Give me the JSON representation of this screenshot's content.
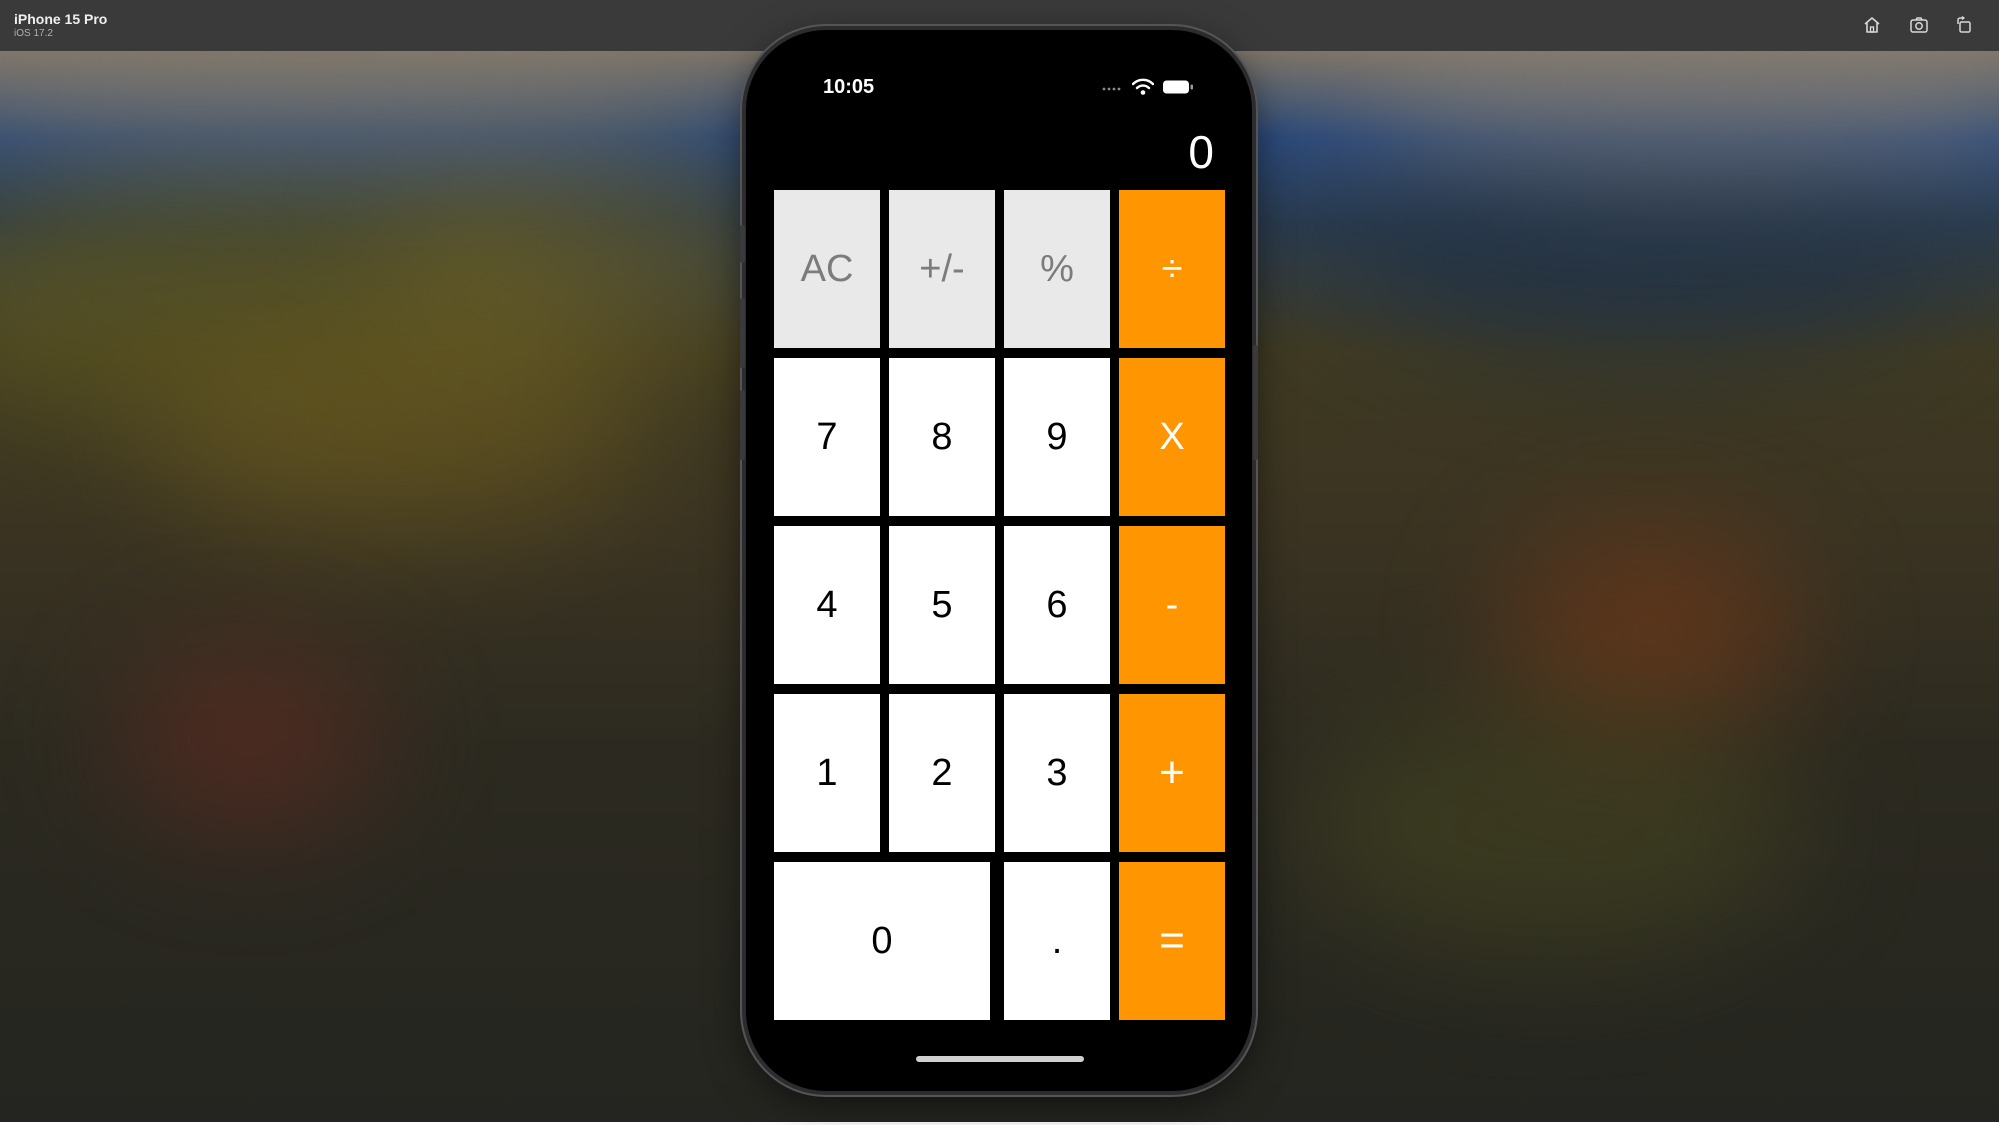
{
  "simulator": {
    "device_name": "iPhone 15 Pro",
    "os_version": "iOS 17.2",
    "toolbar_icons": [
      "home-icon",
      "screenshot-icon",
      "rotate-icon"
    ]
  },
  "status_bar": {
    "time": "10:05",
    "icons": [
      "cellular-signal-icon",
      "wifi-icon",
      "battery-icon"
    ]
  },
  "calculator": {
    "display_value": "0",
    "colors": {
      "function_key_bg": "#e9e9e9",
      "function_key_text": "#7c7c7c",
      "number_key_bg": "#ffffff",
      "operator_key_bg": "#ff9500",
      "operator_key_text": "#ffffff",
      "screen_bg": "#000000"
    },
    "keys": {
      "ac": "AC",
      "plus_minus": "+/-",
      "percent": "%",
      "divide": "÷",
      "seven": "7",
      "eight": "8",
      "nine": "9",
      "multiply": "X",
      "four": "4",
      "five": "5",
      "six": "6",
      "minus": "-",
      "one": "1",
      "two": "2",
      "three": "3",
      "plus": "+",
      "zero": "0",
      "decimal": ".",
      "equals": "="
    }
  }
}
